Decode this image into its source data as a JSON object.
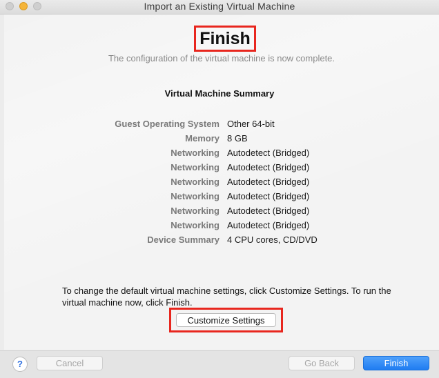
{
  "window": {
    "title": "Import an Existing Virtual Machine"
  },
  "page": {
    "title": "Finish",
    "subtitle": "The configuration of the virtual machine is now complete."
  },
  "summary": {
    "heading": "Virtual Machine Summary",
    "rows": [
      {
        "label": "Guest Operating System",
        "value": "Other 64-bit"
      },
      {
        "label": "Memory",
        "value": "8 GB"
      },
      {
        "label": "Networking",
        "value": "Autodetect (Bridged)"
      },
      {
        "label": "Networking",
        "value": "Autodetect (Bridged)"
      },
      {
        "label": "Networking",
        "value": "Autodetect (Bridged)"
      },
      {
        "label": "Networking",
        "value": "Autodetect (Bridged)"
      },
      {
        "label": "Networking",
        "value": "Autodetect (Bridged)"
      },
      {
        "label": "Networking",
        "value": "Autodetect (Bridged)"
      },
      {
        "label": "Device Summary",
        "value": "4 CPU cores, CD/DVD"
      }
    ]
  },
  "instructions": "To change the default virtual machine settings, click Customize Settings. To run the virtual machine now, click Finish.",
  "buttons": {
    "customize": "Customize Settings",
    "help": "?",
    "cancel": "Cancel",
    "go_back": "Go Back",
    "finish": "Finish"
  },
  "icons": {
    "help": "question-mark-icon"
  },
  "colors": {
    "highlight": "#e8261e",
    "primary_button": "#1f7cf1"
  }
}
